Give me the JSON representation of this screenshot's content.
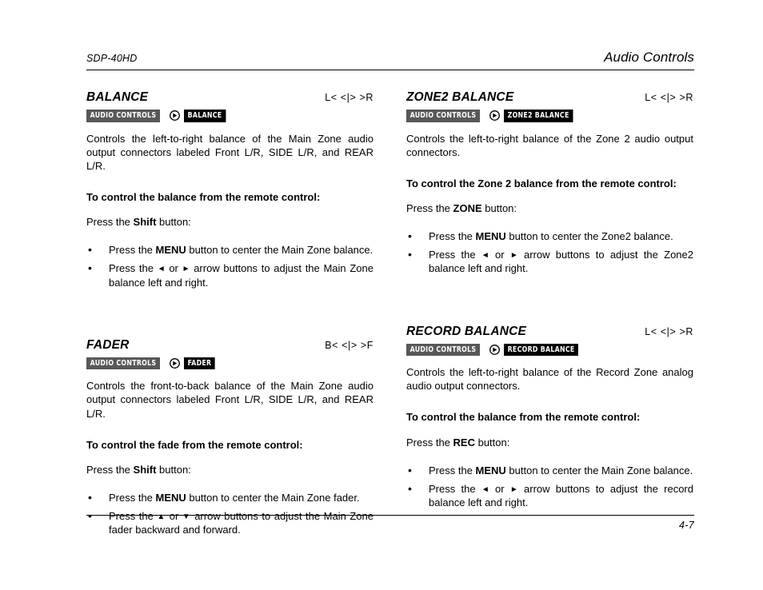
{
  "header": {
    "model": "SDP-40HD",
    "chapter_title": "Audio Controls"
  },
  "footer": {
    "page_number": "4-7"
  },
  "icons": {
    "crumb_separator": "circle-right-arrow-icon",
    "arrow_left": "◄",
    "arrow_right": "►",
    "arrow_up": "▲",
    "arrow_down": "▼"
  },
  "colors": {
    "crumb_parent_bg": "#585858",
    "crumb_current_bg": "#000000",
    "crumb_text": "#ffffff",
    "rule": "#000000"
  },
  "sections": {
    "balance": {
      "title": "BALANCE",
      "range": "L<  <|>  >R",
      "crumb_parent": "AUDIO CONTROLS",
      "crumb_current": "BALANCE",
      "description": "Controls the left-to-right balance of the Main Zone audio output connectors labeled Front L/R, SIDE L/R, and REAR L/R.",
      "lead": "To control the balance from the remote control:",
      "press_prefix": "Press the ",
      "press_key": "Shift",
      "press_suffix": " button:",
      "bullet1_pre": "Press the ",
      "bullet1_key": "MENU",
      "bullet1_post": " button to center the Main Zone balance.",
      "bullet2_pre": "Press the ",
      "bullet2_arrow_a": "◄",
      "bullet2_mid": " or ",
      "bullet2_arrow_b": "►",
      "bullet2_post": " arrow buttons to adjust the Main Zone balance left and right."
    },
    "zone2_balance": {
      "title": "ZONE2 BALANCE",
      "range": "L<  <|>  >R",
      "crumb_parent": "AUDIO CONTROLS",
      "crumb_current": "ZONE2 BALANCE",
      "description": "Controls the left-to-right balance of the Zone 2 audio output connectors.",
      "lead": "To control the Zone 2 balance from the remote control:",
      "press_prefix": "Press the ",
      "press_key": "ZONE",
      "press_suffix": " button:",
      "bullet1_pre": "Press the ",
      "bullet1_key": "MENU",
      "bullet1_post": " button to center the Zone2 balance.",
      "bullet2_pre": "Press the ",
      "bullet2_arrow_a": "◄",
      "bullet2_mid": " or ",
      "bullet2_arrow_b": "►",
      "bullet2_post": " arrow buttons to adjust the Zone2 balance left and right."
    },
    "fader": {
      "title": "FADER",
      "range": "B<  <|>  >F",
      "crumb_parent": "AUDIO CONTROLS",
      "crumb_current": "FADER",
      "description": "Controls the front-to-back balance of the Main Zone audio output connectors labeled Front L/R, SIDE L/R, and REAR L/R.",
      "lead": "To control the fade from the remote control:",
      "press_prefix": "Press the ",
      "press_key": "Shift",
      "press_suffix": " button:",
      "bullet1_pre": "Press the ",
      "bullet1_key": "MENU",
      "bullet1_post": " button to center the Main Zone fader.",
      "bullet2_pre": "Press the ",
      "bullet2_arrow_a": "▲",
      "bullet2_mid": " or ",
      "bullet2_arrow_b": "▼",
      "bullet2_post": " arrow buttons to adjust the Main Zone fader backward and forward."
    },
    "record_balance": {
      "title": "RECORD BALANCE",
      "range": "L<  <|>  >R",
      "crumb_parent": "AUDIO CONTROLS",
      "crumb_current": "RECORD BALANCE",
      "description": "Controls the left-to-right balance of the Record Zone analog audio output connectors.",
      "lead": "To control the balance from the remote control:",
      "press_prefix": "Press the ",
      "press_key": "REC",
      "press_suffix": " button:",
      "bullet1_pre": "Press the ",
      "bullet1_key": "MENU",
      "bullet1_post": " button to center the Main Zone balance.",
      "bullet2_pre": "Press the ",
      "bullet2_arrow_a": "◄",
      "bullet2_mid": " or ",
      "bullet2_arrow_b": "►",
      "bullet2_post": " arrow buttons to adjust the record balance left and right."
    }
  }
}
